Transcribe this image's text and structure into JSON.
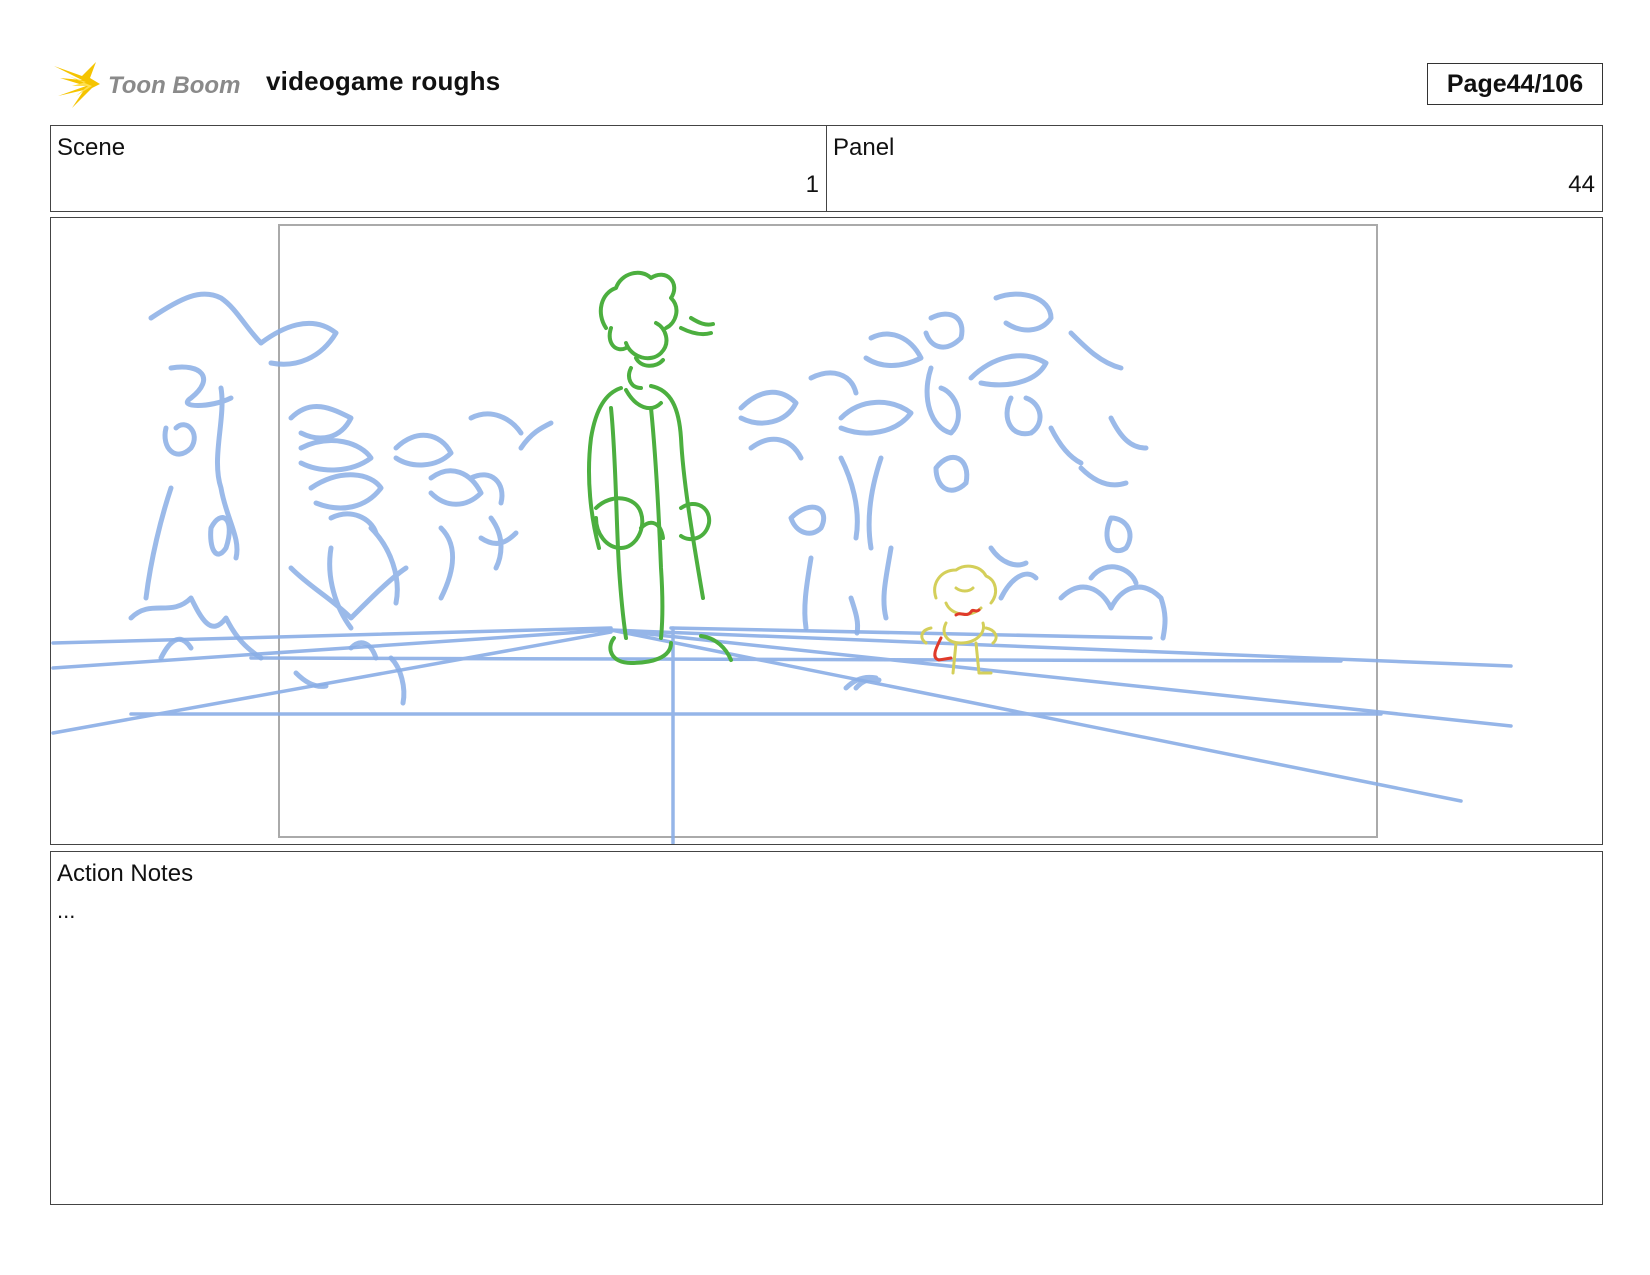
{
  "header": {
    "logo_text": "Toon Boom",
    "project_title": "videogame roughs",
    "page_label": "Page",
    "page_value": "44/106"
  },
  "info": {
    "scene_label": "Scene",
    "scene_value": "1",
    "panel_label": "Panel",
    "panel_value": "44"
  },
  "notes": {
    "label": "Action Notes",
    "text": "..."
  },
  "colors": {
    "sketch_blue": "#8aaee6",
    "character_green": "#4caf3f",
    "character_yellow": "#d4cf5a",
    "accent_red": "#e03a2a",
    "logo_yellow": "#f5c400"
  }
}
